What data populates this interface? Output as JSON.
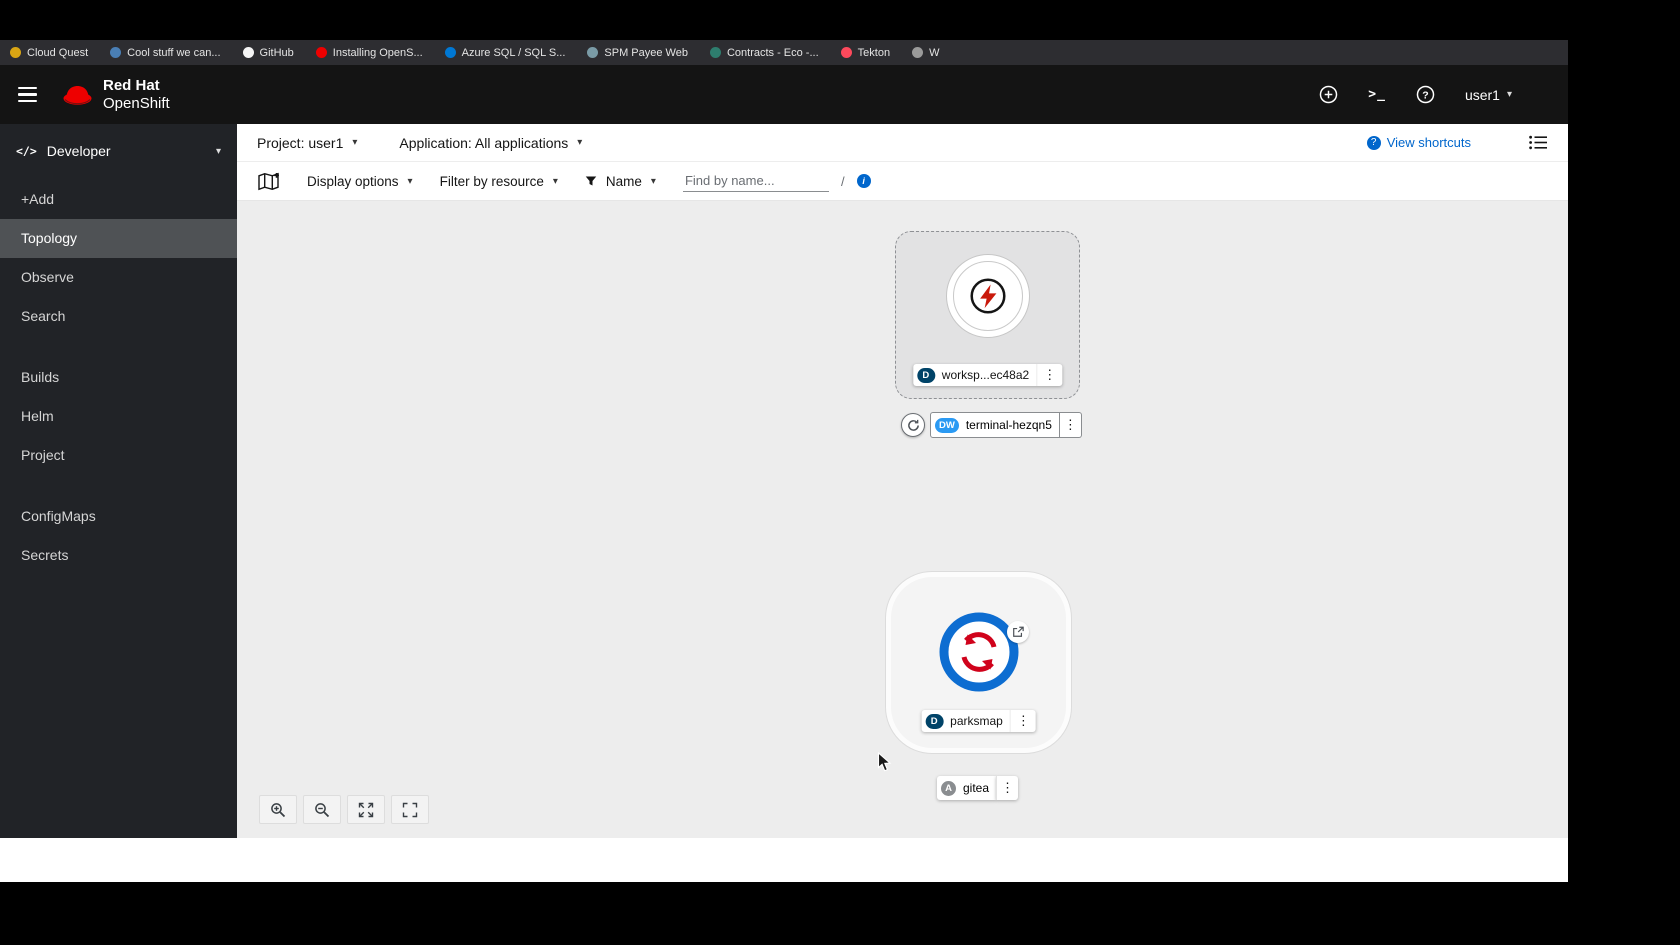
{
  "colors": {
    "accent_blue": "#0066cc",
    "brand_red": "#ee0000",
    "masthead_bg": "#141414",
    "sidebar_bg": "#212327",
    "sidebar_active_bg": "#4f5255",
    "canvas_bg": "#ededed",
    "badge_deployment": "#004368",
    "badge_devworkspace": "#2b9af3",
    "badge_application": "#8a8d90",
    "workspace_bolt_red": "#c9190b",
    "parksmap_ring_blue": "#0d6dd1",
    "parksmap_arrows_red": "#d0021b"
  },
  "icons": {
    "caret_down": "▾",
    "kebab": "⋮",
    "terminal_prompt": ">_",
    "question_mark": "?",
    "info_i": "i",
    "dev_brackets": "</>"
  },
  "bookmarks_bar": {
    "items": [
      {
        "label": "Cloud Quest",
        "color": "#d9a514"
      },
      {
        "label": "Cool stuff we can...",
        "color": "#4a7fb5"
      },
      {
        "label": "GitHub",
        "color": "#f5f5f5"
      },
      {
        "label": "Installing OpenS...",
        "color": "#ee0000"
      },
      {
        "label": "Azure SQL / SQL S...",
        "color": "#0078d4"
      },
      {
        "label": "SPM Payee Web",
        "color": "#7a9ba6"
      },
      {
        "label": "Contracts - Eco -...",
        "color": "#2e7d6e"
      },
      {
        "label": "Tekton",
        "color": "#fd495c"
      },
      {
        "label": "W",
        "color": "#9a9a9a"
      }
    ]
  },
  "masthead": {
    "brand_line1": "Red Hat",
    "brand_line2": "OpenShift",
    "username": "user1"
  },
  "sidebar": {
    "perspective": "Developer",
    "nav1": [
      {
        "label": "+Add"
      },
      {
        "label": "Topology"
      },
      {
        "label": "Observe"
      },
      {
        "label": "Search"
      }
    ],
    "nav2": [
      {
        "label": "Builds"
      },
      {
        "label": "Helm"
      },
      {
        "label": "Project"
      }
    ],
    "nav3": [
      {
        "label": "ConfigMaps"
      },
      {
        "label": "Secrets"
      }
    ]
  },
  "context_bar": {
    "project": "Project: user1",
    "application": "Application: All applications",
    "view_shortcuts": "View shortcuts"
  },
  "filter_bar": {
    "display_options": "Display options",
    "filter_by_resource": "Filter by resource",
    "name_filter": "Name",
    "search_placeholder": "Find by name...",
    "shortcut_key": "/"
  },
  "topology": {
    "workspace": {
      "badge": "D",
      "label": "worksp...ec48a2"
    },
    "terminal": {
      "badge": "DW",
      "label": "terminal-hezqn5"
    },
    "parksmap": {
      "badge": "D",
      "label": "parksmap"
    },
    "gitea": {
      "badge": "A",
      "label": "gitea"
    }
  }
}
